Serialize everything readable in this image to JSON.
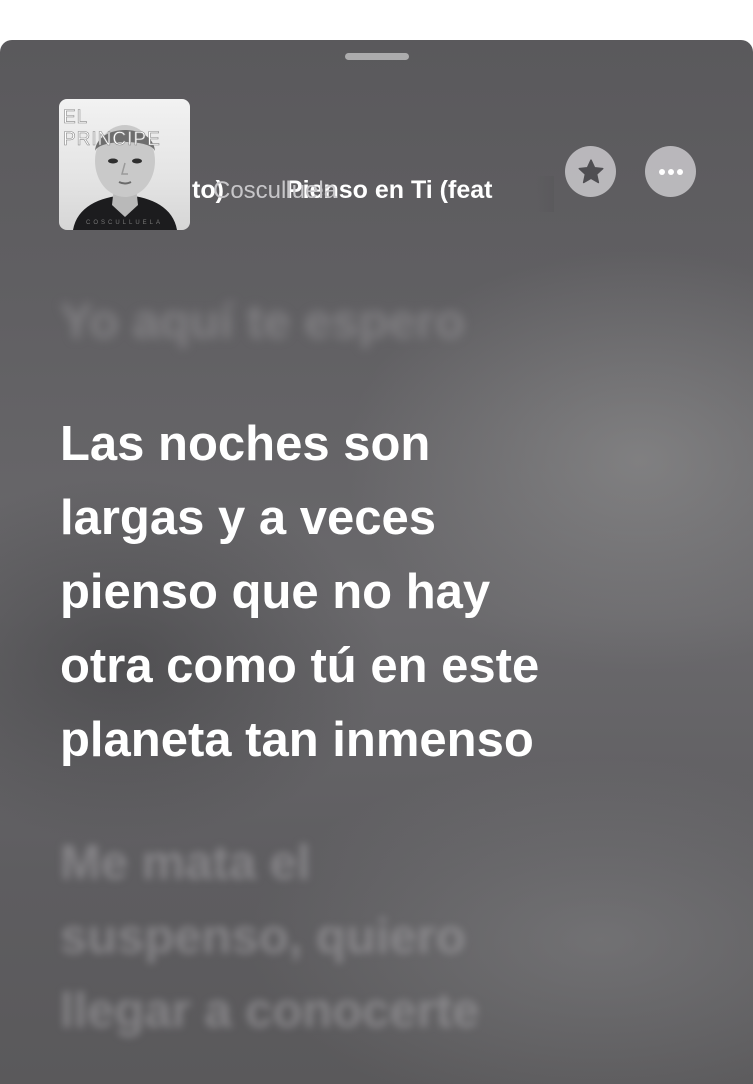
{
  "player": {
    "song_title_marquee_tail": "to)",
    "song_title": "Pienso en Ti (feat",
    "artist": "Cosculluela",
    "artwork": {
      "cover_title": "EL PRINCIPE",
      "cover_artist": "COSCULLUELA"
    },
    "favorite_icon": "star-icon",
    "more_icon": "ellipsis-icon"
  },
  "lyrics": {
    "previous_line": "Yo aquí te espero",
    "current_line": "Las noches son\nlargas y a veces\npienso que no hay\notra como tú en este\nplaneta tan inmenso",
    "next_line": "Me mata el\nsuspenso, quiero\nllegar a conocerte"
  },
  "colors": {
    "background": "#626164",
    "active_lyric": "#ffffff",
    "inactive_lyric": "#9a999c",
    "artist_text": "#c7c6c9",
    "button_bg": "#cdccd0",
    "button_icon": "#4f4e52"
  }
}
